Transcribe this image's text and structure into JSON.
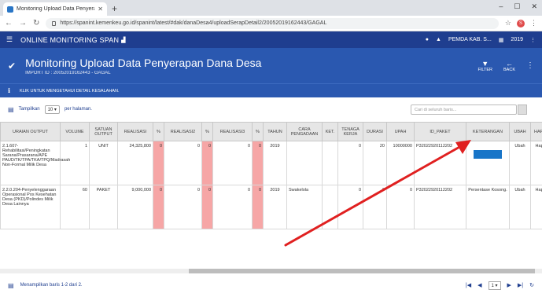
{
  "browser": {
    "tab_title": "Monitoring Upload Data Penyerapan",
    "new_tab": "+",
    "url": "https://spanint.kemenkeu.go.id/spanint/latest/#dak/danaDesa4/uploadSerapDetail2/20052019162443/GAGAL",
    "window_controls": [
      "–",
      "☐",
      "✕"
    ],
    "profile_initial": "S"
  },
  "app": {
    "brand": "ONLINE MONITORING SPAN",
    "user": "PEMDA KAB. S...",
    "year": "2019"
  },
  "page": {
    "title": "Monitoring Upload Data Penyerapan Dana Desa",
    "subtitle": "IMPORT ID : 20052019162443 - GAGAL",
    "filter_label": "FILTER",
    "back_label": "BACK",
    "info_text": "KLIK UNTUK MENGETAHUI DETAIL KESALAHAN."
  },
  "toolbar": {
    "show_label": "Tampilkan",
    "page_size": "10",
    "per_page_label": "per halaman.",
    "search_placeholder": "Cari di seluruh baris..."
  },
  "table": {
    "headers": [
      "URAIAN OUTPUT",
      "VOLUME",
      "SATUAN OUTPUT",
      "REALISASI",
      "%",
      "REALISASI2",
      "%",
      "REALISASI3",
      "%",
      "TAHUN",
      "CARA PENGADAAN",
      "KET.",
      "TENAGA KERJA",
      "DURASI",
      "UPAH",
      "ID_PAKET",
      "KETERANGAN",
      "UBAH",
      "HAPUS"
    ],
    "rows": [
      [
        "2.1.607-Rehabilitasi/Peningkatan Sarana/Prasarana/APE PAUD/TK/TPA/TKA/TPQ/Madrasah Non-Formal Milik Desa",
        "1",
        "UNIT",
        "24,325,800",
        "0",
        "0",
        "0",
        "0",
        "0",
        "2019",
        "",
        "",
        "0",
        "20",
        "10000000",
        "P32022920112202",
        "",
        "Ubah",
        "Hapus"
      ],
      [
        "2.2.0.204-Penyelenggaraan Operasional Pos Kesehatan Desa (PKD)/Polindes Milik Desa Lainnya",
        "60",
        "PAKET",
        "9,000,000",
        "0",
        "0",
        "0",
        "0",
        "0",
        "2019",
        "Swakelola",
        "",
        "0",
        "0",
        "0",
        "P32022920112202",
        "Persentase Kosong.",
        "Ubah",
        "Hapus"
      ]
    ]
  },
  "footer": {
    "showing_text": "Menampilkan baris 1-2 dari 2.",
    "page_value": "1"
  },
  "colors": {
    "app_header": "#1f3e8f",
    "page_header": "#2a58b0",
    "percent_cell": "#f6a6a6",
    "annotation_arrow": "#e02020"
  }
}
